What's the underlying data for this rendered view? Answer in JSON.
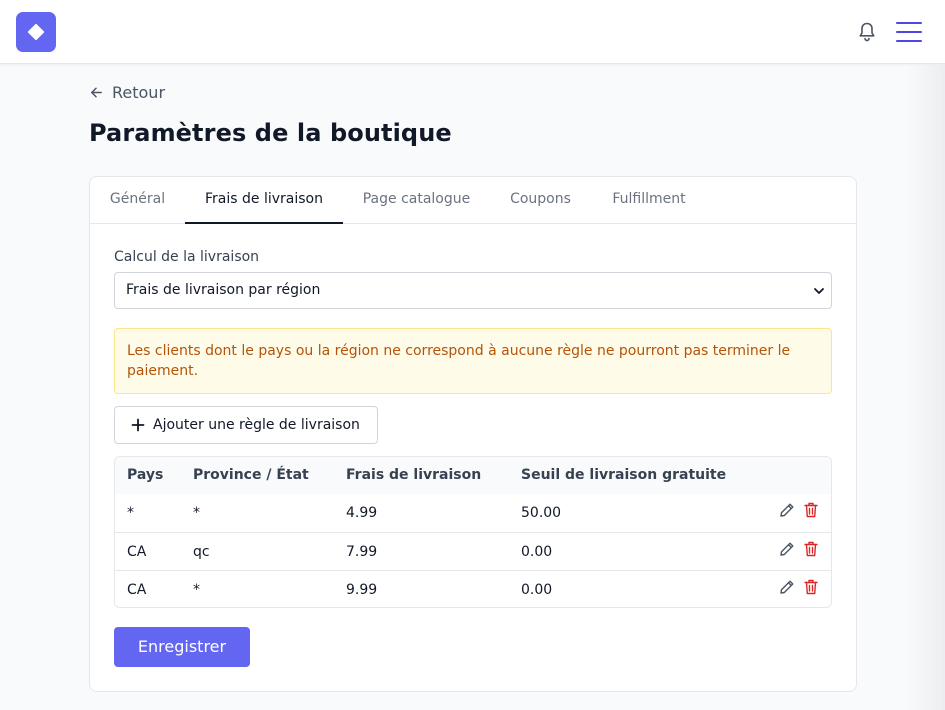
{
  "header": {
    "logo_icon": "diamond-icon",
    "notifications_icon": "bell-icon",
    "menu_icon": "hamburger-menu-icon",
    "brand_color": "#6366f1"
  },
  "back_link": {
    "label": "Retour",
    "icon": "arrow-left-icon"
  },
  "page_title": "Paramètres de la boutique",
  "tabs": [
    {
      "label": "Général",
      "active": false
    },
    {
      "label": "Frais de livraison",
      "active": true
    },
    {
      "label": "Page catalogue",
      "active": false
    },
    {
      "label": "Coupons",
      "active": false
    },
    {
      "label": "Fulfillment",
      "active": false
    }
  ],
  "shipping": {
    "calc_label": "Calcul de la livraison",
    "calc_value": "Frais de livraison par région",
    "warning": "Les clients dont le pays ou la région ne correspond à aucune règle ne pourront pas terminer le paiement.",
    "add_rule_label": "Ajouter une règle de livraison",
    "add_rule_icon": "plus-icon"
  },
  "rules_table": {
    "columns": [
      "Pays",
      "Province / État",
      "Frais de livraison",
      "Seuil de livraison gratuite"
    ],
    "rows": [
      {
        "country": "*",
        "province": "*",
        "fee": "4.99",
        "free_threshold": "50.00"
      },
      {
        "country": "CA",
        "province": "qc",
        "fee": "7.99",
        "free_threshold": "0.00"
      },
      {
        "country": "CA",
        "province": "*",
        "fee": "9.99",
        "free_threshold": "0.00"
      }
    ],
    "edit_icon": "pencil-icon",
    "delete_icon": "trash-icon",
    "delete_color": "#dc2626"
  },
  "save_label": "Enregistrer"
}
